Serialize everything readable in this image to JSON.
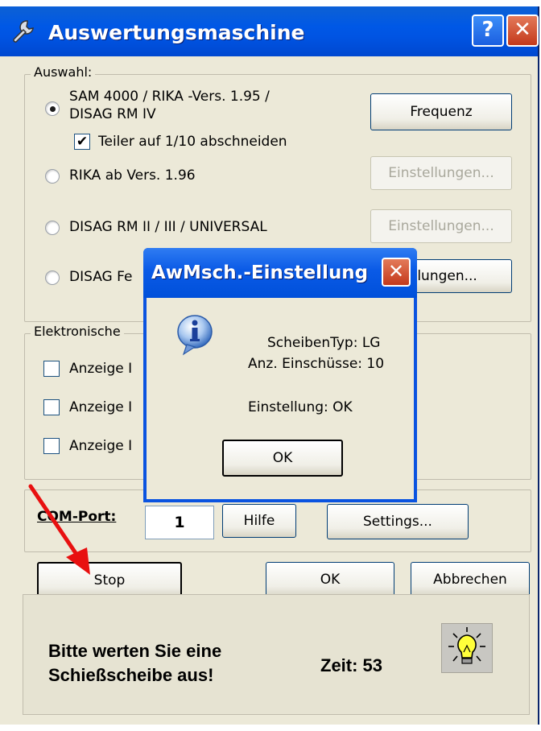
{
  "window": {
    "title": "Auswertungsmaschine",
    "help_button": "?",
    "close_button": "✕"
  },
  "auswahl": {
    "label": "Auswahl:",
    "options": [
      {
        "label_line1": "SAM 4000 / RIKA -Vers. 1.95 /",
        "label_line2": "DISAG RM IV",
        "selected": true
      },
      {
        "label": "RIKA ab Vers. 1.96",
        "selected": false
      },
      {
        "label": "DISAG RM II / III / UNIVERSAL",
        "selected": false
      },
      {
        "label": "DISAG Fe",
        "selected": false
      }
    ],
    "teiler_checkbox": {
      "label": "Teiler auf 1/10 abschneiden",
      "checked": true
    },
    "buttons": [
      {
        "label": "Frequenz",
        "enabled": true
      },
      {
        "label": "Einstellungen...",
        "enabled": false
      },
      {
        "label": "Einstellungen...",
        "enabled": false
      },
      {
        "label": "ellungen...",
        "enabled": true
      }
    ]
  },
  "elektronische": {
    "label": "Elektronische",
    "checkboxes": [
      {
        "label": "Anzeige I",
        "checked": false
      },
      {
        "label": "Anzeige I",
        "checked": false
      },
      {
        "label": "Anzeige I",
        "checked": false
      }
    ]
  },
  "com": {
    "label": "COM-Port:",
    "value": "1",
    "hilfe_button": "Hilfe",
    "settings_button": "Settings..."
  },
  "actions": {
    "stop": "Stop",
    "ok": "OK",
    "abbrechen": "Abbrechen"
  },
  "status": {
    "message_line1": "Bitte werten Sie eine",
    "message_line2": "Schießscheibe aus!",
    "timer": "Zeit: 53"
  },
  "dialog": {
    "title": "AwMsch.-Einstellung",
    "close_button": "✕",
    "line1": "ScheibenTyp: LG",
    "line2": "Anz. Einschüsse: 10",
    "line3": "Einstellung: OK",
    "ok_button": "OK"
  },
  "colors": {
    "titlebar": "#0054e3",
    "window_bg": "#ece9d8",
    "arrow": "#e81010"
  },
  "icons": [
    "wrench-icon",
    "info-icon",
    "lightbulb-icon",
    "arrow-annotation"
  ]
}
